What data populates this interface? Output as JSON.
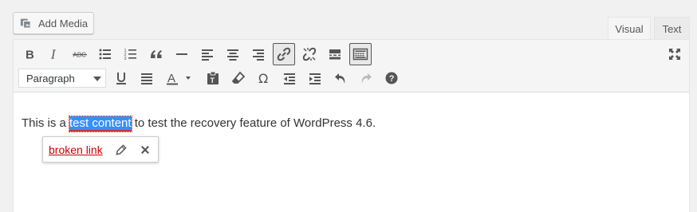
{
  "add_media": {
    "label": "Add Media",
    "icon": "media-icon"
  },
  "tabs": [
    {
      "label": "Visual",
      "active": true
    },
    {
      "label": "Text",
      "active": false
    }
  ],
  "toolbar": {
    "format_select": {
      "value": "Paragraph"
    },
    "row1": [
      "bold",
      "italic",
      "strikethrough",
      "bulleted-list",
      "numbered-list",
      "blockquote",
      "horizontal-line",
      "align-left",
      "align-center",
      "align-right",
      "insert-link",
      "remove-link",
      "read-more",
      "toolbar-toggle"
    ],
    "row2": [
      "underline",
      "justify",
      "text-color",
      "paste-as-text",
      "clear-formatting",
      "special-character",
      "decrease-indent",
      "increase-indent",
      "undo",
      "redo",
      "help"
    ],
    "fullscreen": "fullscreen"
  },
  "content": {
    "before": "This is a ",
    "selected": "test content",
    "after": " to test the recovery feature of WordPress 4.6."
  },
  "link_popup": {
    "link_text": "broken link",
    "edit_icon": "pencil-icon",
    "remove_icon": "close-icon"
  },
  "colors": {
    "selection": "#3390ff",
    "broken_link": "#cc0000",
    "icon": "#555555"
  }
}
